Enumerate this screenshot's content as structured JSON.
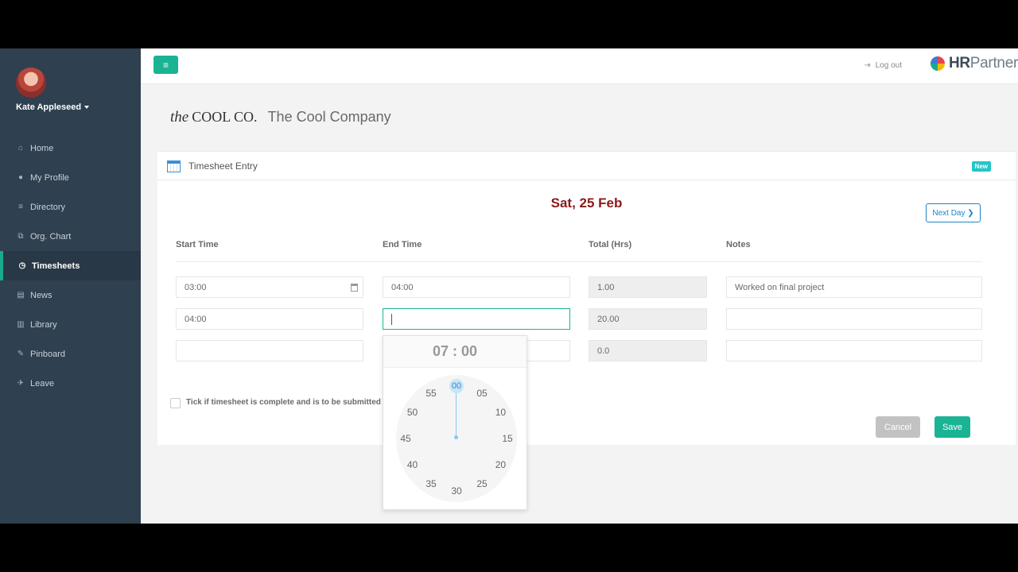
{
  "user": {
    "name": "Kate Appleseed"
  },
  "nav": [
    {
      "icon": "home-icon",
      "glyph": "⌂",
      "label": "Home",
      "active": false
    },
    {
      "icon": "user-icon",
      "glyph": "●",
      "label": "My Profile",
      "active": false
    },
    {
      "icon": "list-icon",
      "glyph": "≡",
      "label": "Directory",
      "active": false
    },
    {
      "icon": "sitemap-icon",
      "glyph": "⧉",
      "label": "Org. Chart",
      "active": false
    },
    {
      "icon": "clock-icon",
      "glyph": "◷",
      "label": "Timesheets",
      "active": true
    },
    {
      "icon": "newspaper-icon",
      "glyph": "▤",
      "label": "News",
      "active": false
    },
    {
      "icon": "book-icon",
      "glyph": "▥",
      "label": "Library",
      "active": false
    },
    {
      "icon": "pin-icon",
      "glyph": "✎",
      "label": "Pinboard",
      "active": false
    },
    {
      "icon": "plane-icon",
      "glyph": "✈",
      "label": "Leave",
      "active": false
    }
  ],
  "topbar": {
    "logout": "Log out",
    "brand_bold": "HR",
    "brand_light": "Partner"
  },
  "company": {
    "logo_italic": "the",
    "logo_text": "COOL CO.",
    "name": "The Cool Company"
  },
  "panel": {
    "title": "Timesheet Entry",
    "badge": "New",
    "date": "Sat, 25 Feb",
    "next_day": "Next Day ❯"
  },
  "columns": {
    "start": "Start Time",
    "end": "End Time",
    "total": "Total (Hrs)",
    "notes": "Notes"
  },
  "rows": [
    {
      "start": "03:00",
      "end": "04:00",
      "total": "1.00",
      "notes": "Worked on final project"
    },
    {
      "start": "04:00",
      "end": "",
      "total": "20.00",
      "notes": ""
    },
    {
      "start": "",
      "end": "",
      "total": "0.0",
      "notes": ""
    }
  ],
  "checkbox_label": "Tick if timesheet is complete and is to be submitted f",
  "buttons": {
    "cancel": "Cancel",
    "save": "Save"
  },
  "clock": {
    "display": "07 : 00",
    "selected": "00",
    "minutes": [
      "00",
      "05",
      "10",
      "15",
      "20",
      "25",
      "30",
      "35",
      "40",
      "45",
      "50",
      "55"
    ]
  },
  "colors": {
    "accent": "#1ab394",
    "sidebar": "#2f4050",
    "date": "#8b1a1a",
    "link": "#1c84c6"
  }
}
